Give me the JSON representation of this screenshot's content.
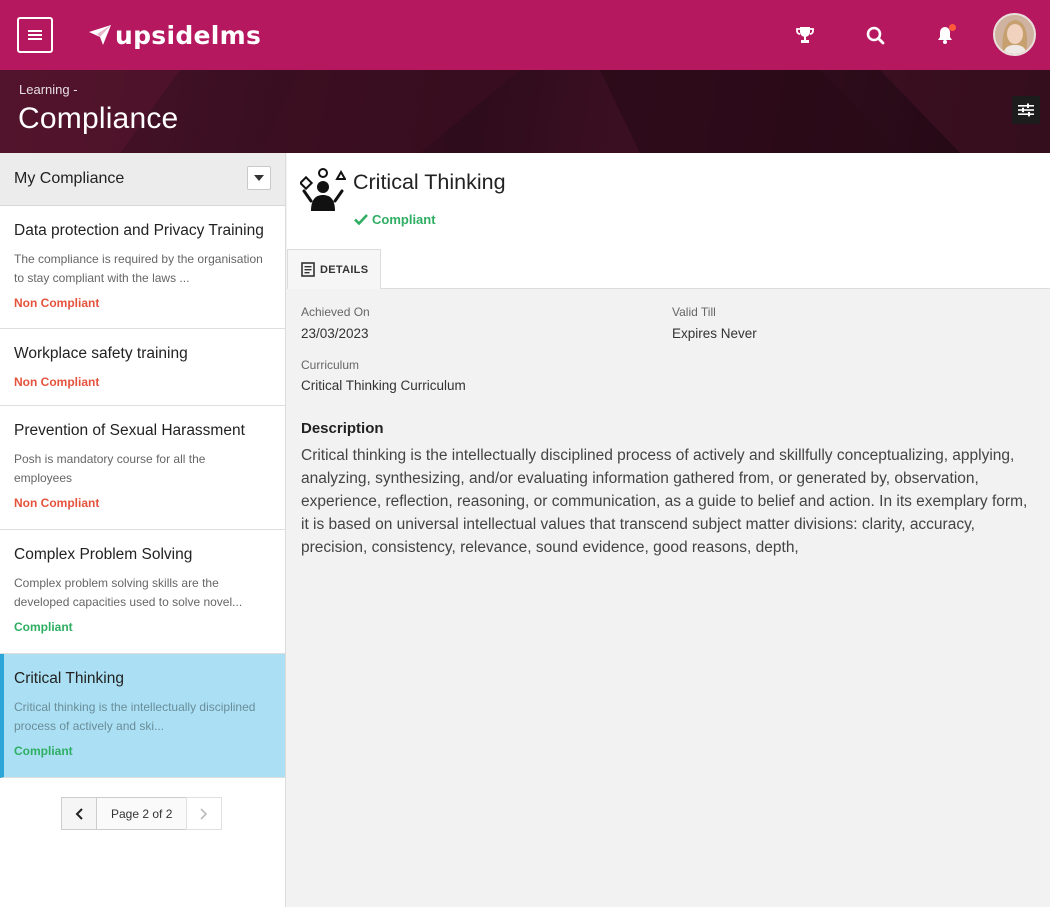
{
  "app": {
    "logo_text": "upsidelms"
  },
  "header": {
    "breadcrumb": "Learning -",
    "title": "Compliance"
  },
  "sidebar": {
    "title": "My Compliance",
    "items": [
      {
        "name": "Data protection and Privacy Training",
        "desc_line1": "The compliance is required by the organisation",
        "desc_line2": "to stay compliant with the laws ...",
        "status": "Non Compliant"
      },
      {
        "name": "Workplace safety training",
        "status": "Non Compliant"
      },
      {
        "name": "Prevention of Sexual Harassment",
        "desc_line1": "Posh is mandatory course for all the",
        "desc_line2": "employees",
        "status": "Non Compliant"
      },
      {
        "name": "Complex Problem Solving",
        "desc_line1": "Complex problem solving skills are the",
        "desc_line2": "developed capacities used to solve novel...",
        "status": "Compliant"
      },
      {
        "name": "Critical Thinking",
        "desc_line1": "Critical thinking is the intellectually disciplined",
        "desc_line2": "process of actively and ski...",
        "status": "Compliant"
      }
    ],
    "pagination": {
      "label": "Page 2 of 2"
    }
  },
  "detail": {
    "title": "Critical Thinking",
    "status": "Compliant",
    "tab_label": "DETAILS",
    "achieved_label": "Achieved On",
    "achieved_value": "23/03/2023",
    "valid_label": "Valid Till",
    "valid_value": "Expires Never",
    "curriculum_label": "Curriculum",
    "curriculum_value": "Critical Thinking Curriculum",
    "description_title": "Description",
    "description": "Critical thinking is the intellectually disciplined process of actively and skillfully conceptualizing, applying, analyzing, synthesizing, and/or evaluating information gathered from, or generated by, observation, experience, reflection, reasoning, or communication, as a guide to belief and action. In its exemplary form, it is based on universal intellectual values that transcend subject matter divisions: clarity, accuracy, precision, consistency, relevance, sound evidence, good reasons, depth,"
  },
  "colors": {
    "brand": "#b5185f",
    "compliant": "#2fae63",
    "non_compliant": "#e5533d",
    "active_item": "#abe0f4",
    "active_border": "#2ba6d6"
  },
  "icons": [
    "menu-icon",
    "logo-plane-icon",
    "trophy-icon",
    "search-icon",
    "bell-icon",
    "filter-sliders-icon",
    "chevron-down-icon",
    "chevron-left-icon",
    "chevron-right-icon",
    "checkmark-icon",
    "document-icon",
    "course-juggler-icon"
  ]
}
